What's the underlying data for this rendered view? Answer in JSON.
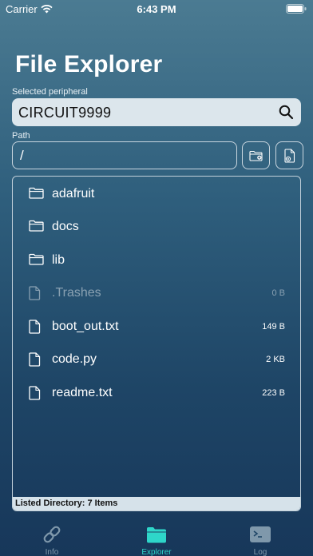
{
  "status_bar": {
    "carrier": "Carrier",
    "time": "6:43 PM"
  },
  "title": "File Explorer",
  "peripheral": {
    "label": "Selected peripheral",
    "value": "CIRCUIT9999"
  },
  "path": {
    "label": "Path",
    "value": "/"
  },
  "files": [
    {
      "name": "adafruit",
      "type": "folder",
      "size": ""
    },
    {
      "name": "docs",
      "type": "folder",
      "size": ""
    },
    {
      "name": "lib",
      "type": "folder",
      "size": ""
    },
    {
      "name": ".Trashes",
      "type": "file",
      "size": "0 B",
      "dimmed": true
    },
    {
      "name": "boot_out.txt",
      "type": "file",
      "size": "149 B"
    },
    {
      "name": "code.py",
      "type": "file",
      "size": "2 KB"
    },
    {
      "name": "readme.txt",
      "type": "file",
      "size": "223 B"
    }
  ],
  "listing_status": "Listed Directory: 7 Items",
  "tabs": {
    "info": "Info",
    "explorer": "Explorer",
    "log": "Log"
  },
  "colors": {
    "accent": "#2ed6c9",
    "inactive_tab": "#7f98ab"
  }
}
